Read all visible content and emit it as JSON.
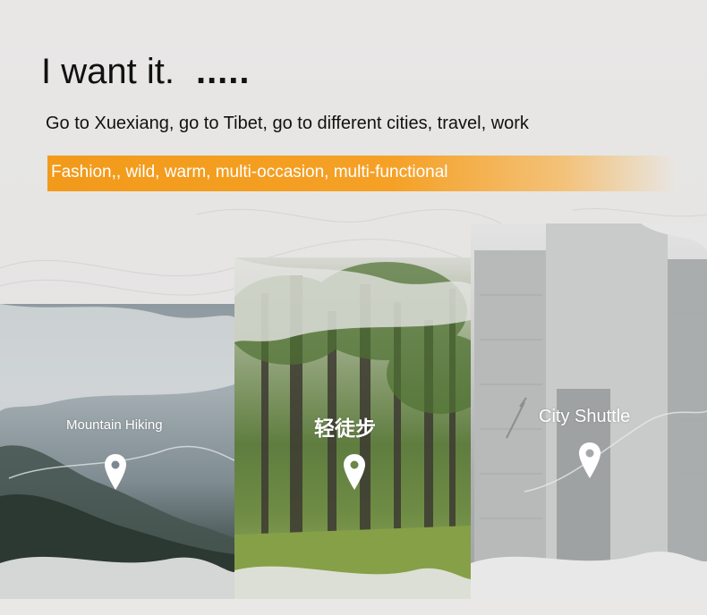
{
  "header": {
    "headline": "I want it.",
    "dots": ".....",
    "subline": "Go to Xuexiang, go to Tibet, go to different cities, travel, work"
  },
  "banner": {
    "text": "Fashion,, wild, warm, multi-occasion, multi-functional",
    "color_start": "#f29a1a",
    "color_end": "#f3c27a"
  },
  "panels": [
    {
      "label": "Mountain Hiking",
      "icon": "location-pin-icon"
    },
    {
      "label": "轻徒步",
      "icon": "location-pin-icon"
    },
    {
      "label": "City Shuttle",
      "icon": "location-pin-icon"
    }
  ],
  "colors": {
    "background": "#e6e5e4",
    "text": "#111111",
    "label_text": "#ffffff"
  }
}
